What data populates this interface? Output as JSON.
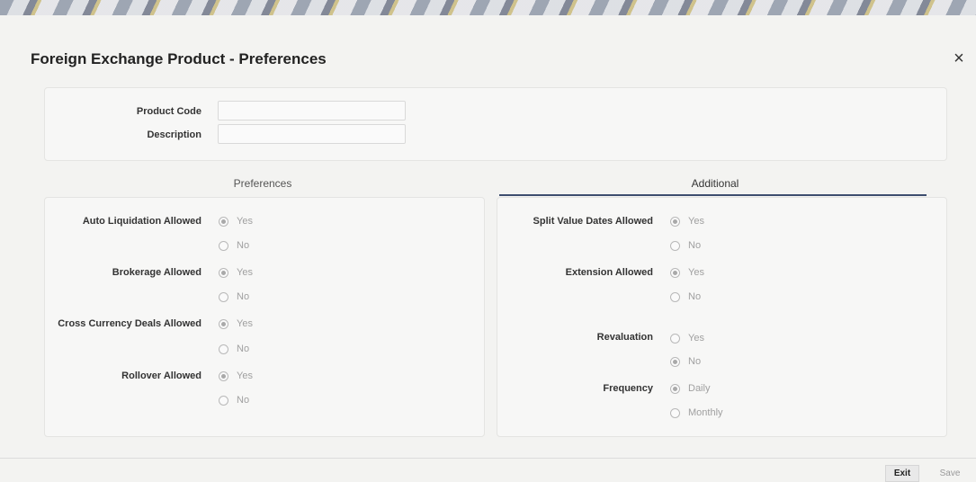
{
  "window": {
    "title": "Foreign Exchange Product - Preferences",
    "close_symbol": "×"
  },
  "header_form": {
    "product_code_label": "Product Code",
    "product_code_value": "",
    "description_label": "Description",
    "description_value": ""
  },
  "tabs": [
    {
      "label": "Preferences",
      "active": false
    },
    {
      "label": "Additional",
      "active": true
    }
  ],
  "preferences": {
    "auto_liquidation": {
      "label": "Auto Liquidation Allowed",
      "yes": "Yes",
      "no": "No",
      "selected": "Yes"
    },
    "brokerage": {
      "label": "Brokerage Allowed",
      "yes": "Yes",
      "no": "No",
      "selected": "Yes"
    },
    "cross_currency": {
      "label": "Cross Currency Deals Allowed",
      "yes": "Yes",
      "no": "No",
      "selected": "Yes"
    },
    "rollover": {
      "label": "Rollover Allowed",
      "yes": "Yes",
      "no": "No",
      "selected": "Yes"
    }
  },
  "additional": {
    "split_value_dates": {
      "label": "Split Value Dates Allowed",
      "yes": "Yes",
      "no": "No",
      "selected": "Yes"
    },
    "extension": {
      "label": "Extension Allowed",
      "yes": "Yes",
      "no": "No",
      "selected": "Yes"
    },
    "revaluation": {
      "label": "Revaluation",
      "yes": "Yes",
      "no": "No",
      "selected": "No"
    },
    "frequency": {
      "label": "Frequency",
      "daily": "Daily",
      "monthly": "Monthly",
      "selected": "Daily"
    }
  },
  "footer": {
    "exit_label": "Exit",
    "save_label": "Save"
  },
  "colors": {
    "tab_underline": "#3d4d6e",
    "background": "#f3f3f1"
  }
}
